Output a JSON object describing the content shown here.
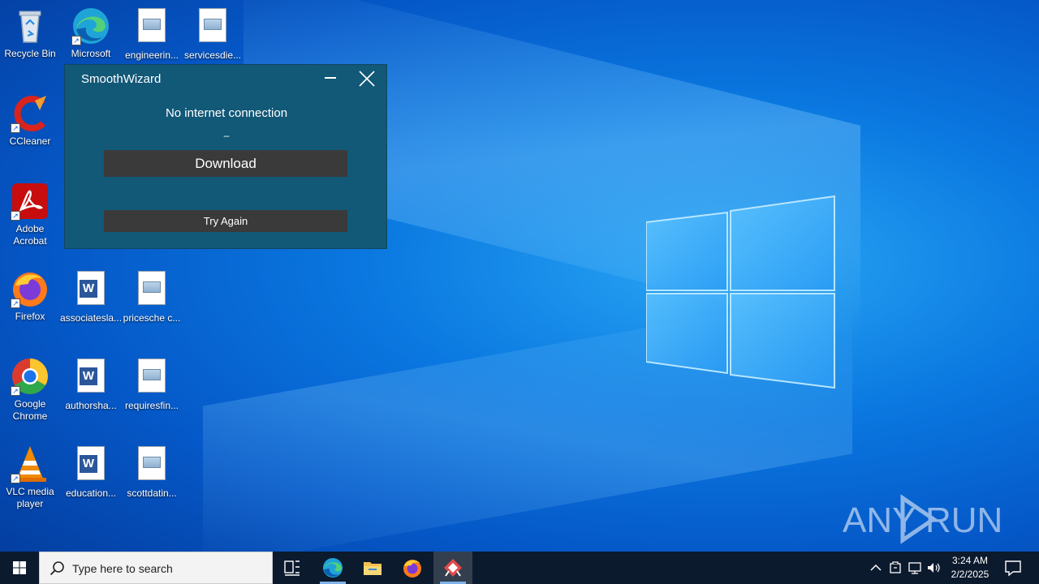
{
  "desktop": {
    "icons": [
      {
        "label": "Recycle Bin"
      },
      {
        "label": "Microsoft Edge"
      },
      {
        "label": "engineerin..."
      },
      {
        "label": "servicesdie..."
      },
      {
        "label": "CCleaner"
      },
      {
        "label": "Adobe Acrobat"
      },
      {
        "label": "Firefox"
      },
      {
        "label": "associatesla..."
      },
      {
        "label": "pricesche c..."
      },
      {
        "label": "Google Chrome"
      },
      {
        "label": "authorsha..."
      },
      {
        "label": "requiresfin..."
      },
      {
        "label": "VLC media player"
      },
      {
        "label": "education..."
      },
      {
        "label": "scottdatin..."
      }
    ]
  },
  "window": {
    "title": "SmoothWizard",
    "status": "No internet connection",
    "dash": "–",
    "download_label": "Download",
    "try_again_label": "Try Again",
    "bg_color": "#125877",
    "button_color": "#3a3a3a"
  },
  "watermark": {
    "text": "ANY RUN"
  },
  "taskbar": {
    "search_placeholder": "Type here to search",
    "time": "3:24 AM",
    "date": "2/2/2025",
    "pinned": [
      "task-view-icon",
      "edge-icon",
      "file-explorer-icon",
      "firefox-icon",
      "smoothwizard-app-icon"
    ],
    "tray": [
      "show-hidden-icons-chevron",
      "security-icon",
      "network-icon",
      "volume-icon"
    ]
  }
}
